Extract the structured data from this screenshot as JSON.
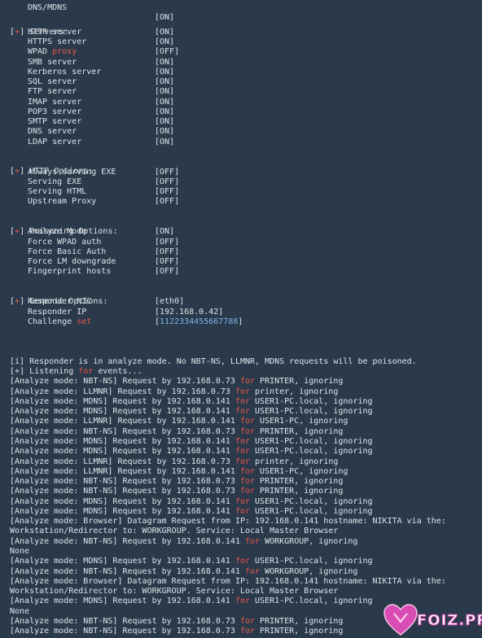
{
  "top_partial": {
    "label": "DNS/MDNS",
    "value": "[ON]"
  },
  "sections": [
    {
      "title": "Servers:",
      "items": [
        {
          "label": "HTTP server",
          "value": "[ON]"
        },
        {
          "label": "HTTPS server",
          "value": "[ON]"
        },
        {
          "label_a": "WPAD ",
          "label_b": "proxy",
          "value": "[OFF]"
        },
        {
          "label": "SMB server",
          "value": "[ON]"
        },
        {
          "label": "Kerberos server",
          "value": "[ON]"
        },
        {
          "label": "SQL server",
          "value": "[ON]"
        },
        {
          "label": "FTP server",
          "value": "[ON]"
        },
        {
          "label": "IMAP server",
          "value": "[ON]"
        },
        {
          "label": "POP3 server",
          "value": "[ON]"
        },
        {
          "label": "SMTP server",
          "value": "[ON]"
        },
        {
          "label": "DNS server",
          "value": "[ON]"
        },
        {
          "label": "LDAP server",
          "value": "[ON]"
        }
      ]
    },
    {
      "title": "HTTP Options:",
      "items": [
        {
          "label": "Always serving EXE",
          "value": "[OFF]"
        },
        {
          "label": "Serving EXE",
          "value": "[OFF]"
        },
        {
          "label": "Serving HTML",
          "value": "[OFF]"
        },
        {
          "label": "Upstream Proxy",
          "value": "[OFF]"
        }
      ]
    },
    {
      "title": "Poisoning Options:",
      "items": [
        {
          "label": "Analyze Mode",
          "value": "[ON]"
        },
        {
          "label": "Force WPAD auth",
          "value": "[OFF]"
        },
        {
          "label": "Force Basic Auth",
          "value": "[OFF]"
        },
        {
          "label": "Force LM downgrade",
          "value": "[OFF]"
        },
        {
          "label": "Fingerprint hosts",
          "value": "[OFF]"
        }
      ]
    },
    {
      "title": "Generic Options:",
      "items": [
        {
          "label": "Responder NIC",
          "value": "[eth0]"
        },
        {
          "label": "Responder IP",
          "value": "[192.168.0.42]"
        },
        {
          "label_a": "Challenge ",
          "label_b": "set",
          "value_a": "[",
          "value_b": "1122334455667788",
          "value_c": "]"
        }
      ]
    }
  ],
  "marker": "[+]",
  "marker_bracket_l": "[",
  "marker_plus": "+",
  "marker_bracket_r": "]",
  "info_line": "[i] Responder is in analyze mode. No NBT-NS, LLMNR, MDNS requests will be poisoned.",
  "listening": {
    "a": "[+] Listening ",
    "b": "for",
    "c": " events..."
  },
  "log": [
    {
      "a": "[Analyze mode: NBT-NS] Request by 192.168.0.73 ",
      "for": "for",
      "b": " PRINTER, ignoring"
    },
    {
      "a": "[Analyze mode: LLMNR] Request by 192.168.0.73 ",
      "for": "for",
      "b": " printer, ignoring"
    },
    {
      "a": "[Analyze mode: MDNS] Request by 192.168.0.141 ",
      "for": "for",
      "b": " USER1-PC.local, ignoring"
    },
    {
      "a": "[Analyze mode: MDNS] Request by 192.168.0.141 ",
      "for": "for",
      "b": " USER1-PC.local, ignoring"
    },
    {
      "a": "[Analyze mode: LLMNR] Request by 192.168.0.141 ",
      "for": "for",
      "b": " USER1-PC, ignoring"
    },
    {
      "a": "[Analyze mode: NBT-NS] Request by 192.168.0.73 ",
      "for": "for",
      "b": " PRINTER, ignoring"
    },
    {
      "a": "[Analyze mode: MDNS] Request by 192.168.0.141 ",
      "for": "for",
      "b": " USER1-PC.local, ignoring"
    },
    {
      "a": "[Analyze mode: MDNS] Request by 192.168.0.141 ",
      "for": "for",
      "b": " USER1-PC.local, ignoring"
    },
    {
      "a": "[Analyze mode: LLMNR] Request by 192.168.0.73 ",
      "for": "for",
      "b": " printer, ignoring"
    },
    {
      "a": "[Analyze mode: LLMNR] Request by 192.168.0.141 ",
      "for": "for",
      "b": " USER1-PC, ignoring"
    },
    {
      "a": "[Analyze mode: NBT-NS] Request by 192.168.0.73 ",
      "for": "for",
      "b": " PRINTER, ignoring"
    },
    {
      "a": "[Analyze mode: NBT-NS] Request by 192.168.0.73 ",
      "for": "for",
      "b": " PRINTER, ignoring"
    },
    {
      "a": "[Analyze mode: MDNS] Request by 192.168.0.141 ",
      "for": "for",
      "b": " USER1-PC.local, ignoring"
    },
    {
      "a": "[Analyze mode: MDNS] Request by 192.168.0.141 ",
      "for": "for",
      "b": " USER1-PC.local, ignoring"
    },
    {
      "a": "[Analyze mode: Browser] Datagram Request from IP: 192.168.0.141 hostname: NIKITA via the:",
      "for": "",
      "b": ""
    },
    {
      "a": "Workstation/Redirector to: WORKGROUP. Service: Local Master Browser",
      "for": "",
      "b": ""
    },
    {
      "a": "[Analyze mode: NBT-NS] Request by 192.168.0.141 ",
      "for": "for",
      "b": " WORKGROUP, ignoring"
    },
    {
      "a": "None",
      "for": "",
      "b": ""
    },
    {
      "a": "[Analyze mode: MDNS] Request by 192.168.0.141 ",
      "for": "for",
      "b": " USER1-PC.local, ignoring"
    },
    {
      "a": "[Analyze mode: NBT-NS] Request by 192.168.0.141 ",
      "for": "for",
      "b": " WORKGROUP, ignoring"
    },
    {
      "a": "[Analyze mode: Browser] Datagram Request from IP: 192.168.0.141 hostname: NIKITA via the:",
      "for": "",
      "b": ""
    },
    {
      "a": "Workstation/Redirector to: WORKGROUP. Service: Local Master Browser",
      "for": "",
      "b": ""
    },
    {
      "a": "[Analyze mode: MDNS] Request by 192.168.0.141 ",
      "for": "for",
      "b": " USER1-PC.local, ignoring"
    },
    {
      "a": "None",
      "for": "",
      "b": ""
    },
    {
      "a": "[Analyze mode: NBT-NS] Request by 192.168.0.73 ",
      "for": "for",
      "b": " PRINTER, ignoring"
    },
    {
      "a": "[Analyze mode: NBT-NS] Request by 192.168.0.73 ",
      "for": "for",
      "b": " PRINTER, ignoring"
    }
  ],
  "watermark": "FOIZ.PRO",
  "colors": {
    "background": "#2b3a4a",
    "text": "#dfe4ea",
    "red": "#e8574a",
    "purple": "#b78cf0",
    "challenge": "#7fb2ea",
    "watermark_pink": "#c83da8"
  }
}
